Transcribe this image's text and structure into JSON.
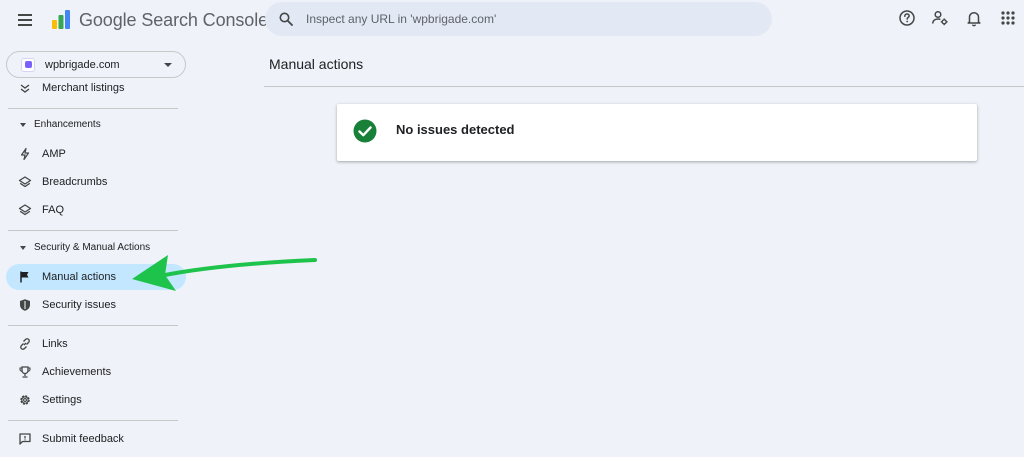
{
  "header": {
    "app_title": "Google Search Console",
    "search_placeholder": "Inspect any URL in 'wpbrigade.com'"
  },
  "property": {
    "name": "wpbrigade.com"
  },
  "sidebar": {
    "items_top": [
      {
        "label": "Merchant listings",
        "icon": "merchant-listings-icon"
      }
    ],
    "sections": [
      {
        "label": "Enhancements",
        "items": [
          {
            "label": "AMP",
            "icon": "amp-bolt-icon"
          },
          {
            "label": "Breadcrumbs",
            "icon": "layers-icon"
          },
          {
            "label": "FAQ",
            "icon": "layers-icon"
          }
        ]
      },
      {
        "label": "Security & Manual Actions",
        "items": [
          {
            "label": "Manual actions",
            "icon": "flag-icon",
            "active": true
          },
          {
            "label": "Security issues",
            "icon": "shield-icon"
          }
        ]
      }
    ],
    "items_bottom": [
      {
        "label": "Links",
        "icon": "link-icon"
      },
      {
        "label": "Achievements",
        "icon": "trophy-icon"
      },
      {
        "label": "Settings",
        "icon": "gear-icon"
      }
    ],
    "feedback": {
      "label": "Submit feedback",
      "icon": "feedback-icon"
    }
  },
  "main": {
    "title": "Manual actions",
    "status_message": "No issues detected"
  },
  "colors": {
    "background": "#eff2f8",
    "active_item": "#c2e7ff",
    "success": "#188038",
    "annotation_arrow": "#1ec34b"
  }
}
